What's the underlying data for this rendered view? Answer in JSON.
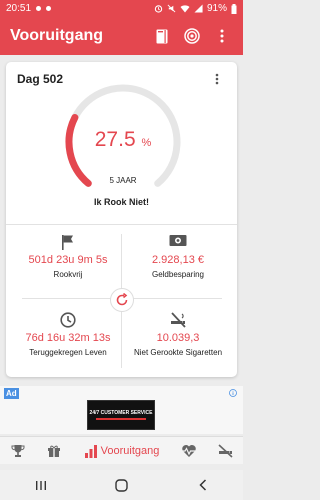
{
  "status": {
    "time": "20:51",
    "battery": "91%"
  },
  "app": {
    "title": "Vooruitgang"
  },
  "card": {
    "day": "Dag 502",
    "progress_value": 27.5,
    "progress_text": "27.5",
    "progress_unit": "%",
    "years": "5 JAAR",
    "quit_message": "Ik Rook Niet!"
  },
  "stats": {
    "smoke_free": {
      "value": "501d 23u 9m 5s",
      "label": "Rookvrij",
      "icon": "flag-icon"
    },
    "money_saved": {
      "value": "2.928,13 €",
      "label": "Geldbesparing",
      "icon": "money-icon"
    },
    "life_regained": {
      "value": "76d 16u 32m 13s",
      "label": "Teruggekregen Leven",
      "icon": "clock-icon"
    },
    "not_smoked": {
      "value": "10.039,3",
      "label": "Niet Gerookte Sigaretten",
      "icon": "no-smoking-icon"
    }
  },
  "ad": {
    "badge": "Ad",
    "banner_text": "24/7 CUSTOMER SERVICE"
  },
  "nav": {
    "active_label": "Vooruitgang",
    "items": [
      "trophy-icon",
      "gift-icon",
      "progress-chart-icon",
      "heartbeat-icon",
      "no-smoking-icon"
    ]
  },
  "colors": {
    "accent": "#e4474f",
    "gauge_track": "#e6e6e6"
  }
}
